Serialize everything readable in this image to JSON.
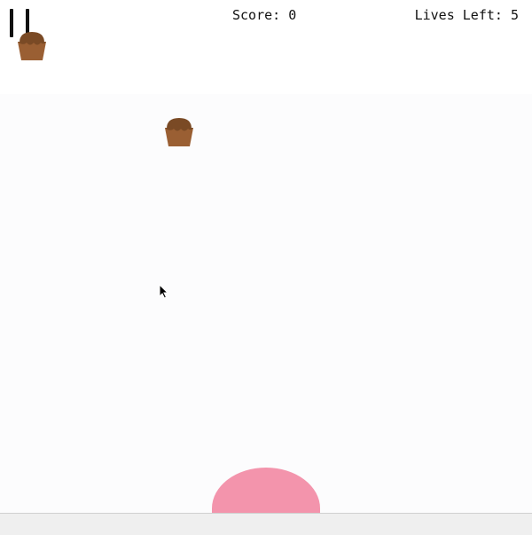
{
  "hud": {
    "score_label": "Score:",
    "score_value": "0",
    "lives_label": "Lives Left:",
    "lives_value": "5"
  },
  "icons": {
    "pause": "pause-icon",
    "muffin": "muffin-icon",
    "cursor": "mouse-cursor-icon"
  },
  "colors": {
    "catcher": "#f394ac",
    "muffin_top": "#7a4a25",
    "muffin_cup": "#9a5f33",
    "background": "#fcfcfd",
    "ground": "#efefef"
  }
}
